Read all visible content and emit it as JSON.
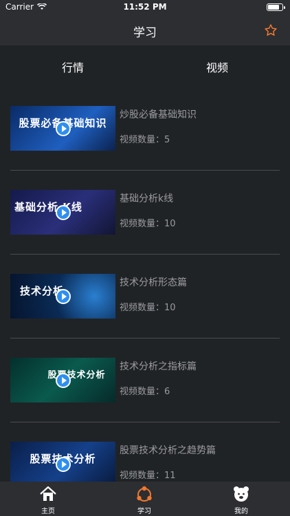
{
  "status_bar": {
    "carrier": "Carrier",
    "time": "11:52 PM",
    "battery_level": 0.8
  },
  "nav": {
    "title": "学习",
    "star_icon": "star-outline-icon",
    "accent": "#f0782d"
  },
  "tabs": [
    {
      "label": "行情"
    },
    {
      "label": "视频"
    }
  ],
  "items": [
    {
      "title": "炒股必备基础知识",
      "count": "视频数量：5",
      "thumb_text": "股票必备基础知识"
    },
    {
      "title": "基础分析k线",
      "count": "视频数量：10",
      "thumb_text": "基础分析 K线"
    },
    {
      "title": "技术分析形态篇",
      "count": "视频数量：10",
      "thumb_text": "技术分析"
    },
    {
      "title": "技术分析之指标篇",
      "count": "视频数量：6",
      "thumb_text": "股票技术分析"
    },
    {
      "title": "股票技术分析之趋势篇",
      "count": "视频数量：11",
      "thumb_text": "股票技术分析"
    }
  ],
  "tabbar": [
    {
      "label": "主页",
      "icon": "home-icon"
    },
    {
      "label": "学习",
      "icon": "study-icon"
    },
    {
      "label": "我的",
      "icon": "bear-avatar-icon"
    }
  ]
}
